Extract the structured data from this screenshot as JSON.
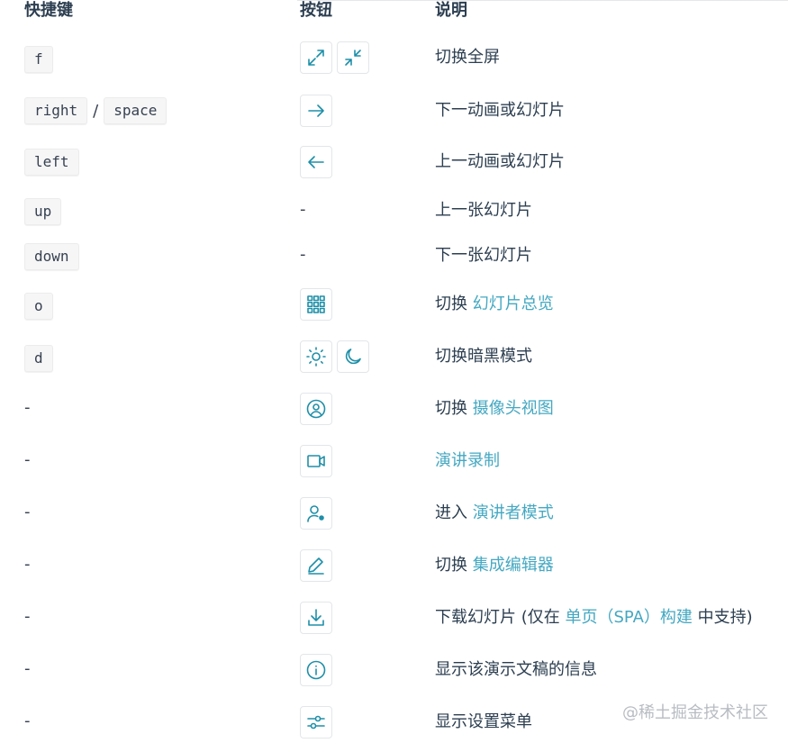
{
  "header": {
    "col1": "快捷键",
    "col2": "按钮",
    "col3": "说明"
  },
  "rows": [
    {
      "keys": [
        "f"
      ],
      "desc": "切换全屏"
    },
    {
      "keys": [
        "right",
        "space"
      ],
      "sep": "/",
      "desc": "下一动画或幻灯片"
    },
    {
      "keys": [
        "left"
      ],
      "desc": "上一动画或幻灯片"
    },
    {
      "keys": [
        "up"
      ],
      "button": "-",
      "desc": "上一张幻灯片"
    },
    {
      "keys": [
        "down"
      ],
      "button": "-",
      "desc": "下一张幻灯片"
    },
    {
      "keys": [
        "o"
      ],
      "desc_prefix": "切换 ",
      "desc_link": "幻灯片总览"
    },
    {
      "keys": [
        "d"
      ],
      "desc": "切换暗黑模式"
    },
    {
      "key_dash": "-",
      "desc_prefix": "切换 ",
      "desc_link": "摄像头视图"
    },
    {
      "key_dash": "-",
      "desc_link": "演讲录制"
    },
    {
      "key_dash": "-",
      "desc_prefix": "进入 ",
      "desc_link": "演讲者模式"
    },
    {
      "key_dash": "-",
      "desc_prefix": "切换 ",
      "desc_link": "集成编辑器"
    },
    {
      "key_dash": "-",
      "desc_prefix": "下载幻灯片 (仅在 ",
      "desc_link": "单页（SPA）构建",
      "desc_suffix": " 中支持)"
    },
    {
      "key_dash": "-",
      "desc": "显示该演示文稿的信息"
    },
    {
      "key_dash": "-",
      "desc": "显示设置菜单"
    }
  ],
  "icons": {
    "r0": [
      "expand-icon",
      "collapse-icon"
    ],
    "r1": [
      "arrow-right-icon"
    ],
    "r2": [
      "arrow-left-icon"
    ],
    "r5": [
      "grid-icon"
    ],
    "r6": [
      "sun-icon",
      "moon-icon"
    ],
    "r7": [
      "user-circle-icon"
    ],
    "r8": [
      "video-icon"
    ],
    "r9": [
      "presenter-icon"
    ],
    "r10": [
      "edit-icon"
    ],
    "r11": [
      "download-icon"
    ],
    "r12": [
      "info-icon"
    ],
    "r13": [
      "settings-sliders-icon"
    ]
  },
  "colors": {
    "link": "#45a8c2",
    "icon": "#1e8fa8",
    "text": "#2c3e50"
  },
  "watermark": "@稀土掘金技术社区"
}
